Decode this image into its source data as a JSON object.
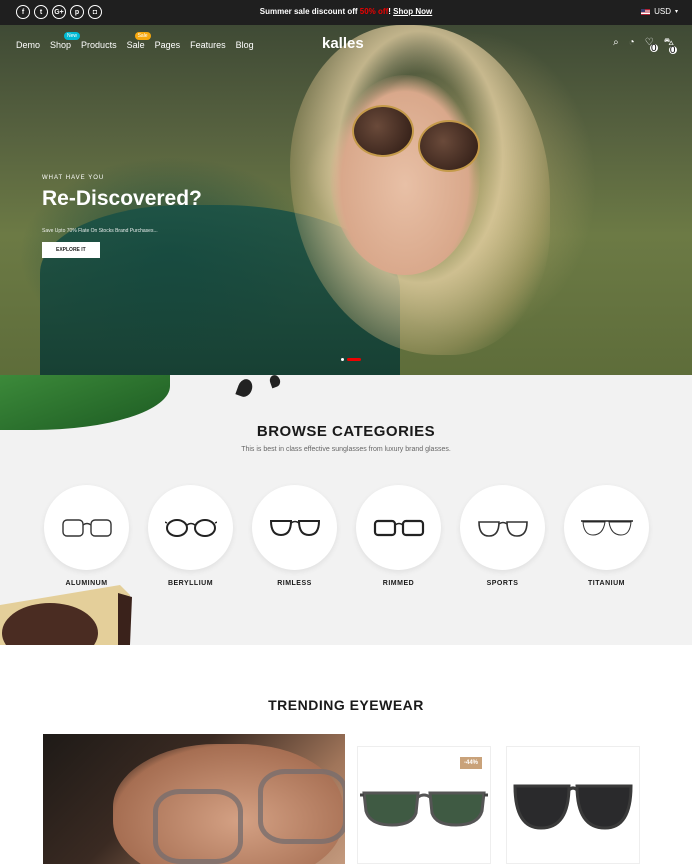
{
  "topbar": {
    "socials": [
      {
        "icon": "facebook-icon",
        "glyph": "f"
      },
      {
        "icon": "twitter-icon",
        "glyph": "t"
      },
      {
        "icon": "google-plus-icon",
        "glyph": "G+"
      },
      {
        "icon": "pinterest-icon",
        "glyph": "p"
      },
      {
        "icon": "instagram-icon",
        "glyph": "◘"
      }
    ],
    "promo_text": "Summer sale discount off ",
    "promo_off": "50% off",
    "promo_sep": "! ",
    "promo_link": "Shop Now",
    "currency": "USD"
  },
  "nav": {
    "items": [
      "Demo",
      "Shop",
      "Products",
      "Sale",
      "Pages",
      "Features",
      "Blog"
    ],
    "badge_new": "New",
    "badge_sale": "Sale",
    "logo": "kalles",
    "wishlist_count": "0",
    "cart_count": "0"
  },
  "hero": {
    "eyebrow": "WHAT HAVE YOU",
    "title": "Re-Discovered?",
    "subtitle": "Save Upto 70% Flate On Stocks Brand Purchases...",
    "button": "EXPLORE IT"
  },
  "categories": {
    "title": "BROWSE CATEGORIES",
    "description": "This is best in class effective sunglasses from luxury brand glasses.",
    "items": [
      "ALUMINUM",
      "BERYLLIUM",
      "RIMLESS",
      "RIMMED",
      "SPORTS",
      "TITANIUM"
    ]
  },
  "trending": {
    "title": "TRENDING EYEWEAR",
    "discount": "-44%"
  },
  "colors": {
    "accent_red": "#ec0101",
    "badge_new": "#01bad4",
    "badge_sale": "#f6a80e",
    "discount": "#c9a27a"
  }
}
